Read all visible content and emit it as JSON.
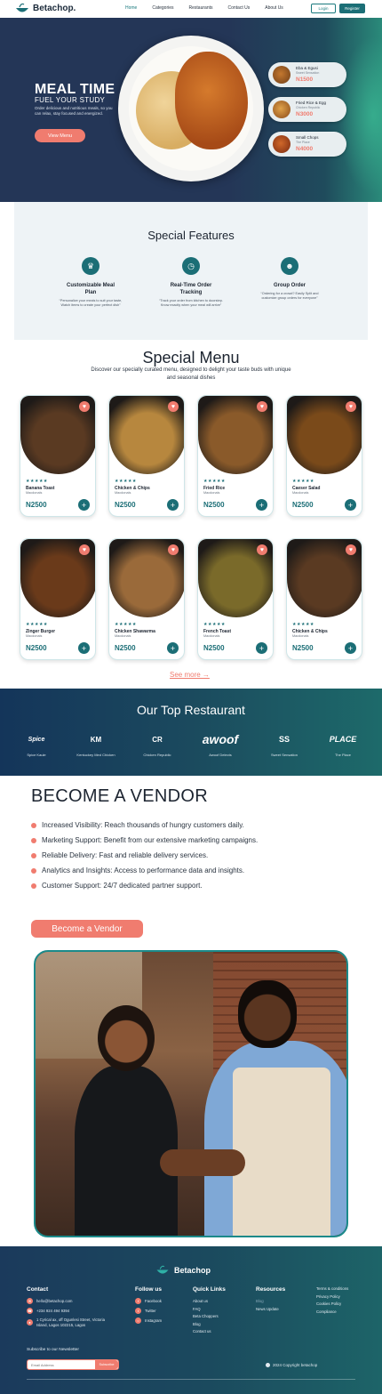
{
  "nav": {
    "brand": "Betachop.",
    "links": [
      "Home",
      "Categories",
      "Restaurants",
      "Contact Us",
      "About Us"
    ],
    "login": "Login",
    "register": "Register"
  },
  "hero": {
    "title": "MEAL TIME",
    "subtitle": "FUEL YOUR STUDY",
    "description": "Order delicious and nutritious meals, so you can relax, stay focused and energized.",
    "cta": "View Menu",
    "cards": [
      {
        "name": "Eba & Egusi",
        "restaurant": "Sweet Sensation",
        "price": "N1500"
      },
      {
        "name": "Fried Rice & Egg",
        "restaurant": "Chicken Republic",
        "price": "N3000"
      },
      {
        "name": "Small Chops",
        "restaurant": "The Place",
        "price": "N4000"
      }
    ]
  },
  "features": {
    "title": "Special Features",
    "items": [
      {
        "icon": "hat-icon",
        "name": "Customizable Meal Plan",
        "desc": "“Personalize your meals to suit your taste, Watch items to create your perfect dish”"
      },
      {
        "icon": "clock-icon",
        "name": "Real-Time Order Tracking",
        "desc": "“Track your order from kitchen to doorstep. Know exactly when your meal will arrive”"
      },
      {
        "icon": "group-icon",
        "name": "Group Order",
        "desc": "“Ordering for a crowd? Easily Split and customize group orders for everyone”"
      }
    ]
  },
  "menu": {
    "title": "Special Menu",
    "description": "Discover our specially curated menu, designed to delight your taste buds with unique and seasonal dishes",
    "stars": "★★★★★",
    "items": [
      {
        "name": "Banana Toast",
        "restaurant": "Macdonals",
        "price": "N2500",
        "color": "#5a3a22"
      },
      {
        "name": "Chicken & Chips",
        "restaurant": "Macdonals",
        "price": "N2500",
        "color": "#b7873e"
      },
      {
        "name": "Fried Rice",
        "restaurant": "Macdonals",
        "price": "N2500",
        "color": "#8a5a2a"
      },
      {
        "name": "Caeser Salad",
        "restaurant": "Macdonals",
        "price": "N2500",
        "color": "#7a4a1a"
      },
      {
        "name": "Zinger Burger",
        "restaurant": "Macdonals",
        "price": "N2500",
        "color": "#6a3a1a"
      },
      {
        "name": "Chicken Shawarma",
        "restaurant": "Macdonals",
        "price": "N2500",
        "color": "#9a6a3a"
      },
      {
        "name": "French Toast",
        "restaurant": "Macdonals",
        "price": "N2500",
        "color": "#7a6a2a"
      },
      {
        "name": "Chicken & Chips",
        "restaurant": "Macdonals",
        "price": "N2500",
        "color": "#5a3a22"
      }
    ],
    "see_more": "See more →"
  },
  "restaurants": {
    "title": "Our Top Restaurant",
    "items": [
      {
        "logo": "Spice",
        "name": "Spice Kaule"
      },
      {
        "logo": "KM",
        "name": "Kentuckey Med Chicken"
      },
      {
        "logo": "CR",
        "name": "Chicken Republic"
      },
      {
        "logo": "awoof",
        "name": "Awoof Delects"
      },
      {
        "logo": "SS",
        "name": "Sweet Sensation"
      },
      {
        "logo": "PLACE",
        "name": "The Place"
      }
    ]
  },
  "vendor": {
    "title": "BECOME A VENDOR",
    "benefits": [
      "Increased Visibility: Reach thousands of hungry customers daily.",
      "Marketing Support: Benefit from our extensive marketing campaigns.",
      "Reliable Delivery: Fast and reliable delivery services.",
      "Analytics and Insights: Access to performance data and insights.",
      "Customer Support: 24/7 dedicated partner support."
    ],
    "cta": "Become a Vendor"
  },
  "footer": {
    "brand": "Betachop",
    "contact": {
      "title": "Contact",
      "email": "hello@betachop.com",
      "phone": "+234 924 494 9394",
      "address": "1 Cyrical ax, off Ogunlesi Street, Victoria Island, Lagos 102215, Lagos"
    },
    "follow": {
      "title": "Follow us",
      "links": [
        "Facebook",
        "Twitter",
        "Instagram"
      ]
    },
    "quick": {
      "title": "Quick Links",
      "links": [
        "About us",
        "FAQ",
        "Beta Choppers",
        "Blog",
        "Contact us"
      ]
    },
    "resources": {
      "title": "Resources",
      "links": [
        "Blog",
        "News Update"
      ]
    },
    "legal": {
      "links": [
        "Terms & conditions",
        "Privacy Policy",
        "Cookies Policy",
        "Compliance"
      ]
    },
    "newsletter": {
      "label": "Subscribe to our Newsletter",
      "placeholder": "Email Address",
      "button": "Subscribe"
    },
    "copyright": "2024 Copyright  betachop"
  },
  "colors": {
    "accent": "#f07c6f",
    "brand": "#1b6e76",
    "navy": "#243657"
  }
}
